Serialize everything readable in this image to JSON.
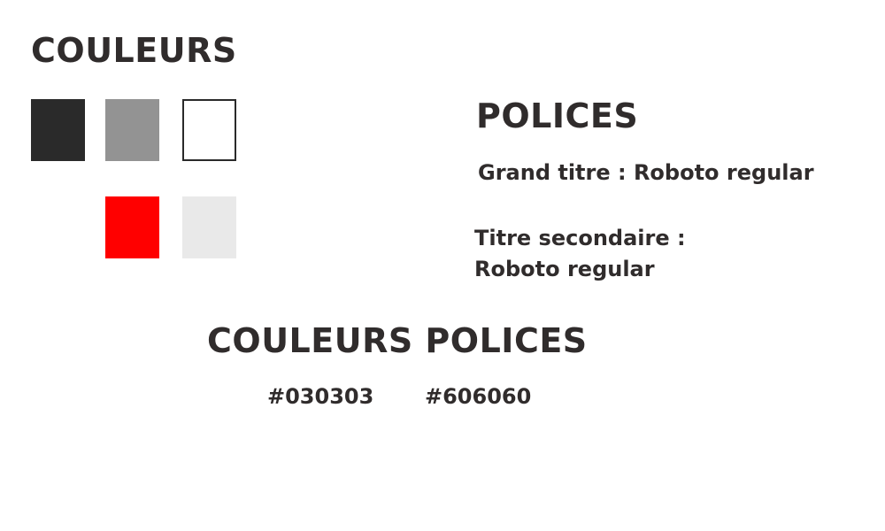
{
  "colors_section": {
    "title": "COULEURS",
    "swatches": [
      {
        "name": "dark",
        "color": "#2a2a2a"
      },
      {
        "name": "gray",
        "color": "#939393"
      },
      {
        "name": "white",
        "color": "#ffffff"
      },
      {
        "name": "red",
        "color": "#ff0000"
      },
      {
        "name": "light-gray",
        "color": "#e9e9e9"
      }
    ]
  },
  "fonts_section": {
    "title": "POLICES",
    "main_title_font": "Grand titre : Roboto regular",
    "secondary_title_font_line1": "Titre secondaire :",
    "secondary_title_font_line2": "Roboto regular"
  },
  "font_colors_section": {
    "title": "COULEURS POLICES",
    "colors": [
      "#030303",
      "#606060"
    ]
  }
}
